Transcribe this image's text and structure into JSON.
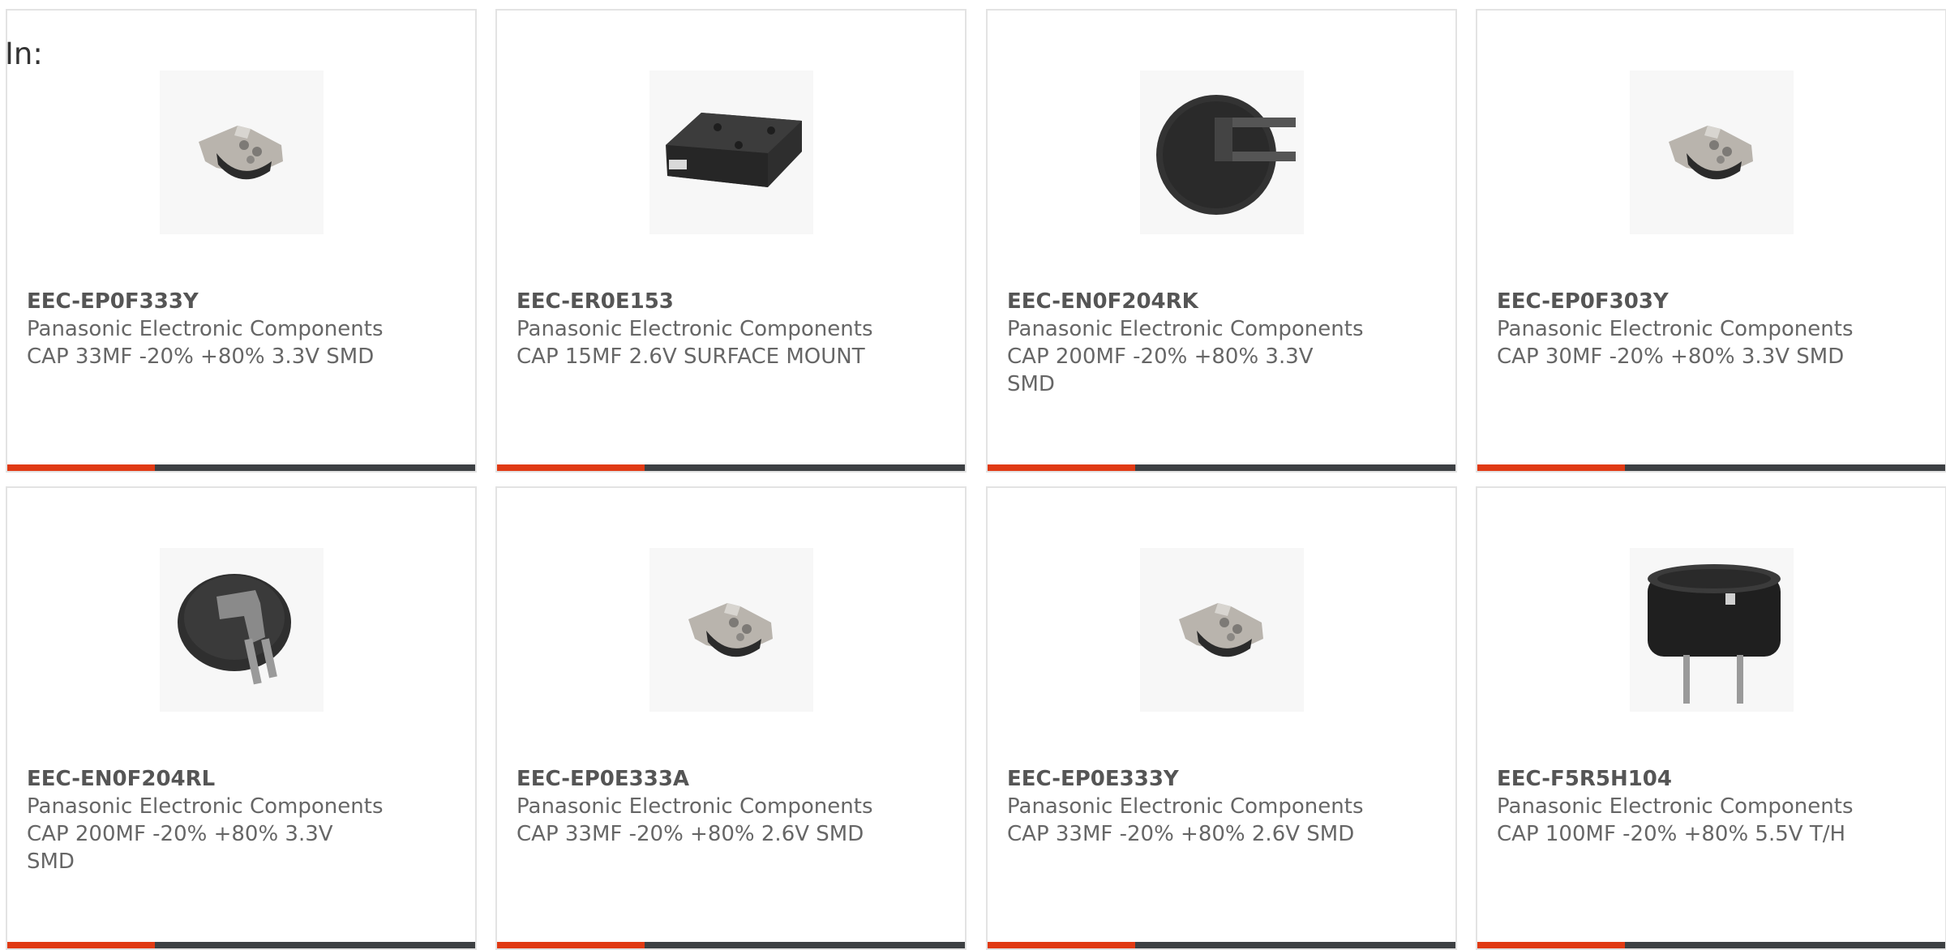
{
  "filter_label": "In:",
  "colors": {
    "accent": "#e03a14",
    "bar": "#3d4043",
    "card_border": "#e3e3e3"
  },
  "products": [
    {
      "part_number": "EEC-EP0F333Y",
      "manufacturer": "Panasonic Electronic Components",
      "description": "CAP 33MF -20% +80% 3.3V SMD",
      "image": "smd-coin-cap-icon"
    },
    {
      "part_number": "EEC-ER0E153",
      "manufacturer": "Panasonic Electronic Components",
      "description": "CAP 15MF 2.6V SURFACE MOUNT",
      "image": "rectangular-smd-cap-icon"
    },
    {
      "part_number": "EEC-EN0F204RK",
      "manufacturer": "Panasonic Electronic Components",
      "description": "CAP 200MF -20% +80% 3.3V SMD",
      "image": "coin-cell-tab-icon"
    },
    {
      "part_number": "EEC-EP0F303Y",
      "manufacturer": "Panasonic Electronic Components",
      "description": "CAP 30MF -20% +80% 3.3V SMD",
      "image": "smd-coin-cap-icon"
    },
    {
      "part_number": "EEC-EN0F204RL",
      "manufacturer": "Panasonic Electronic Components",
      "description": "CAP 200MF -20% +80% 3.3V SMD",
      "image": "coin-cell-leads-icon"
    },
    {
      "part_number": "EEC-EP0E333A",
      "manufacturer": "Panasonic Electronic Components",
      "description": "CAP 33MF -20% +80% 2.6V SMD",
      "image": "smd-coin-cap-icon"
    },
    {
      "part_number": "EEC-EP0E333Y",
      "manufacturer": "Panasonic Electronic Components",
      "description": "CAP 33MF -20% +80% 2.6V SMD",
      "image": "smd-coin-cap-icon"
    },
    {
      "part_number": "EEC-F5R5H104",
      "manufacturer": "Panasonic Electronic Components",
      "description": "CAP 100MF -20% +80% 5.5V T/H",
      "image": "radial-cap-icon"
    }
  ]
}
